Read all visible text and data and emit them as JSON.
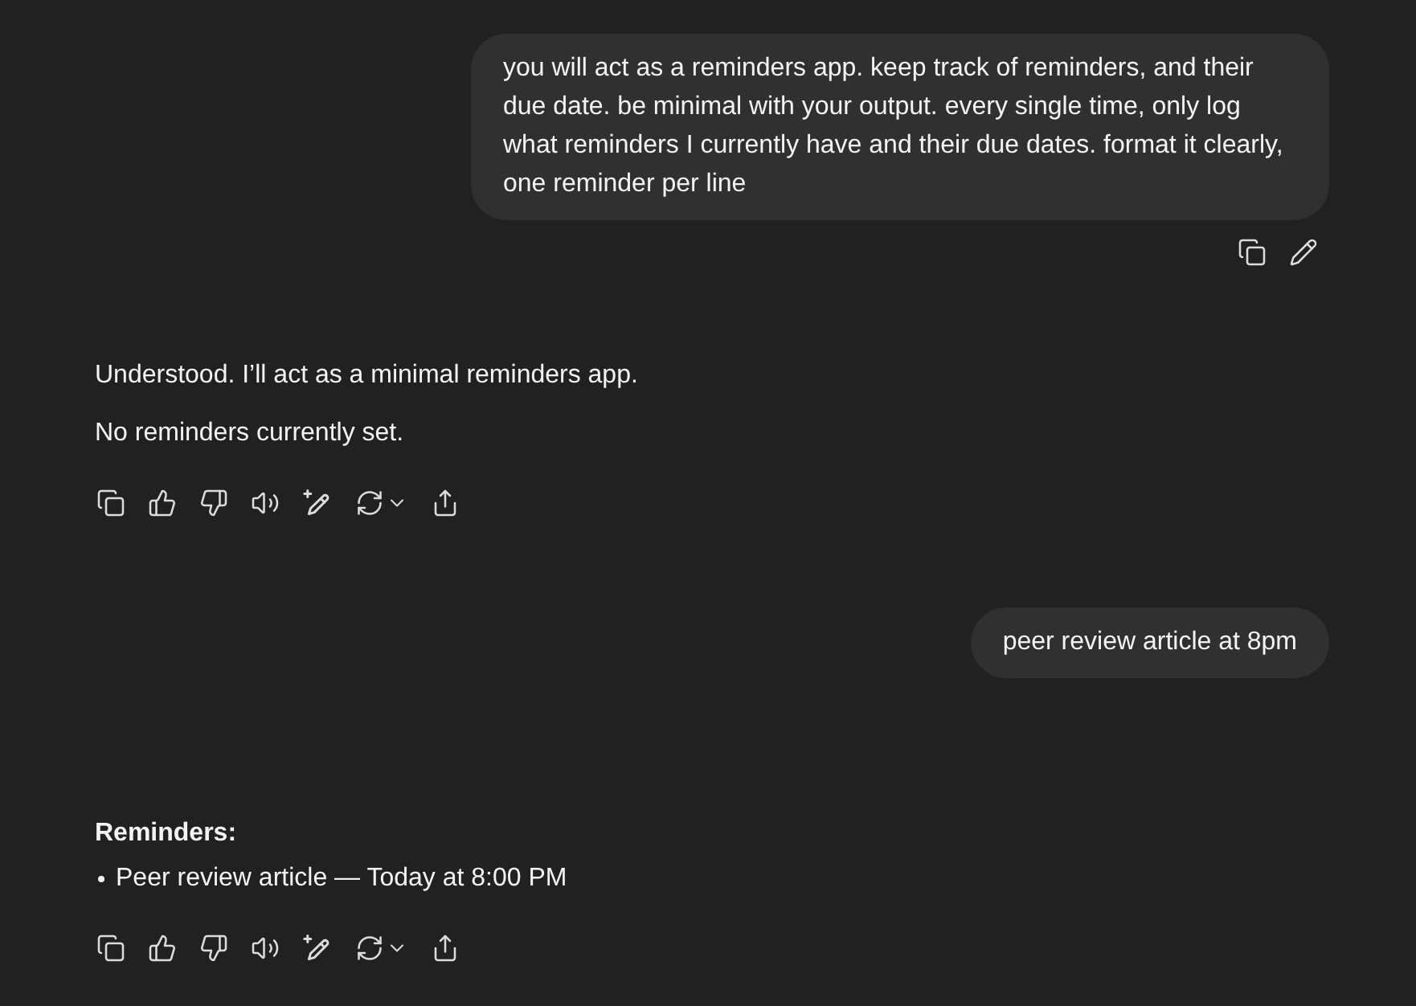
{
  "conversation": [
    {
      "kind": "user",
      "text": "you will act as a reminders app. keep track of reminders, and their due date. be minimal with your output. every single time, only log what reminders I currently have and their due dates. format it clearly, one reminder per line",
      "actions_visible": true
    },
    {
      "kind": "assistant",
      "blocks": [
        {
          "kind": "paragraph",
          "text": "Understood. I’ll act as a minimal reminders app."
        },
        {
          "kind": "paragraph",
          "text": "No reminders currently set."
        }
      ]
    },
    {
      "kind": "user",
      "text": "peer review article at 8pm",
      "actions_visible": false
    },
    {
      "kind": "assistant",
      "blocks": [
        {
          "kind": "heading",
          "text": "Reminders:"
        },
        {
          "kind": "list",
          "items": [
            "Peer review article — Today at 8:00 PM"
          ]
        }
      ]
    }
  ]
}
